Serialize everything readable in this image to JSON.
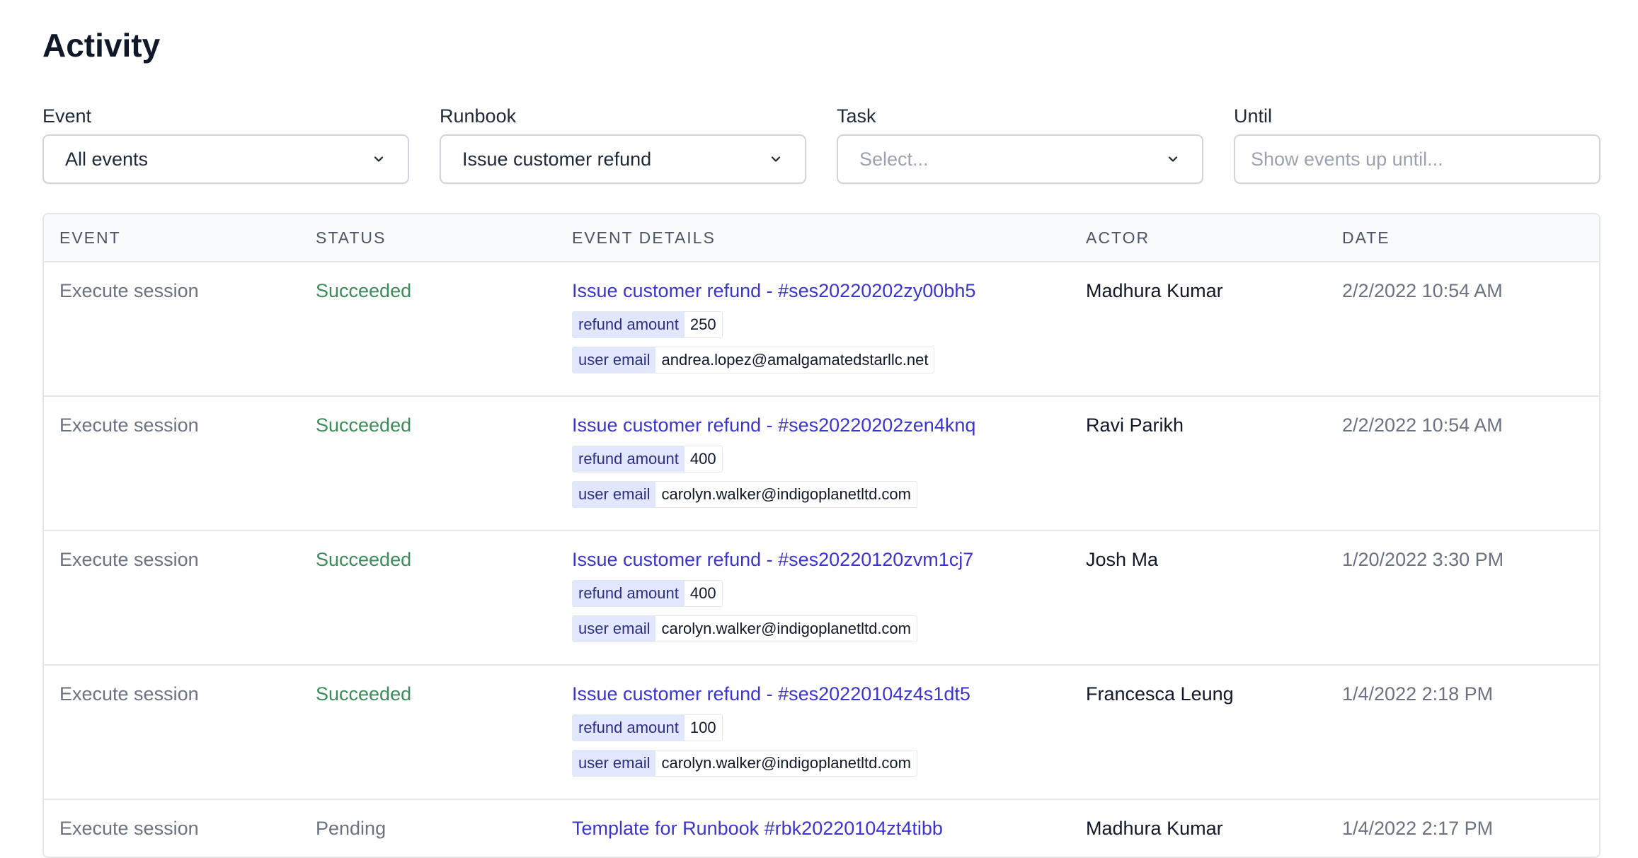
{
  "page": {
    "title": "Activity"
  },
  "filters": {
    "event": {
      "label": "Event",
      "value": "All events"
    },
    "runbook": {
      "label": "Runbook",
      "value": "Issue customer refund"
    },
    "task": {
      "label": "Task",
      "placeholder": "Select..."
    },
    "until": {
      "label": "Until",
      "placeholder": "Show events up until..."
    }
  },
  "table": {
    "headers": [
      "EVENT",
      "STATUS",
      "EVENT DETAILS",
      "ACTOR",
      "DATE"
    ],
    "rows": [
      {
        "event": "Execute session",
        "status": "Succeeded",
        "details": "Issue customer refund - #ses20220202zy00bh5",
        "params": [
          {
            "key": "refund amount",
            "value": "250"
          },
          {
            "key": "user email",
            "value": "andrea.lopez@amalgamatedstarllc.net"
          }
        ],
        "actor": "Madhura Kumar",
        "date": "2/2/2022 10:54 AM"
      },
      {
        "event": "Execute session",
        "status": "Succeeded",
        "details": "Issue customer refund - #ses20220202zen4knq",
        "params": [
          {
            "key": "refund amount",
            "value": "400"
          },
          {
            "key": "user email",
            "value": "carolyn.walker@indigoplanetltd.com"
          }
        ],
        "actor": "Ravi Parikh",
        "date": "2/2/2022 10:54 AM"
      },
      {
        "event": "Execute session",
        "status": "Succeeded",
        "details": "Issue customer refund - #ses20220120zvm1cj7",
        "params": [
          {
            "key": "refund amount",
            "value": "400"
          },
          {
            "key": "user email",
            "value": "carolyn.walker@indigoplanetltd.com"
          }
        ],
        "actor": "Josh Ma",
        "date": "1/20/2022 3:30 PM"
      },
      {
        "event": "Execute session",
        "status": "Succeeded",
        "details": "Issue customer refund - #ses20220104z4s1dt5",
        "params": [
          {
            "key": "refund amount",
            "value": "100"
          },
          {
            "key": "user email",
            "value": "carolyn.walker@indigoplanetltd.com"
          }
        ],
        "actor": "Francesca Leung",
        "date": "1/4/2022 2:18 PM"
      },
      {
        "event": "Execute session",
        "status": "Pending",
        "details": "Template for Runbook #rbk20220104zt4tibb",
        "params": [],
        "actor": "Madhura Kumar",
        "date": "1/4/2022 2:17 PM"
      }
    ]
  },
  "icons": {
    "dropdown": "chevron-down-icon"
  },
  "colors": {
    "link": "#3b36c9",
    "succeeded": "#3d8b5a",
    "pending": "#6b7280",
    "param_key_bg": "#e0e7ff"
  }
}
